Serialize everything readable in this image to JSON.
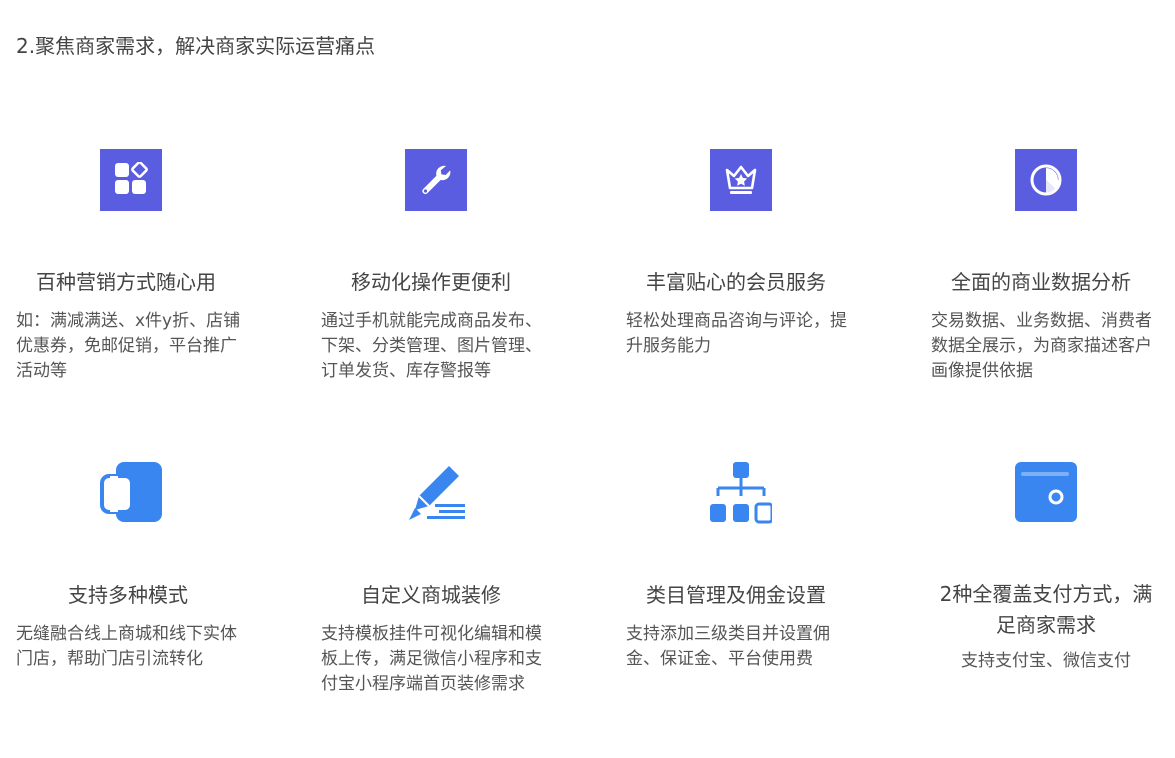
{
  "section": {
    "title": "2.聚焦商家需求，解决商家实际运营痛点"
  },
  "colors": {
    "row1_icon": "#5b5de0",
    "row2_icon": "#3a86f0"
  },
  "features": [
    {
      "icon": "apps-grid-icon",
      "title": "百种营销方式随心用",
      "desc": "如：满减满送、x件y折、店铺优惠券，免邮促销，平台推广活动等"
    },
    {
      "icon": "wrench-icon",
      "title": "移动化操作更便利",
      "desc": "通过手机就能完成商品发布、下架、分类管理、图片管理、订单发货、库存警报等"
    },
    {
      "icon": "crown-star-icon",
      "title": "丰富贴心的会员服务",
      "desc": "轻松处理商品咨询与评论，提升服务能力"
    },
    {
      "icon": "pie-chart-icon",
      "title": "全面的商业数据分析",
      "desc": "交易数据、业务数据、消费者数据全展示，为商家描述客户画像提供依据"
    },
    {
      "icon": "dual-mode-icon",
      "title": "支持多种模式",
      "desc": "无缝融合线上商城和线下实体门店，帮助门店引流转化"
    },
    {
      "icon": "pencil-edit-icon",
      "title": "自定义商城装修",
      "desc": "支持模板挂件可视化编辑和模板上传，满足微信小程序和支付宝小程序端首页装修需求"
    },
    {
      "icon": "hierarchy-icon",
      "title": "类目管理及佣金设置",
      "desc": "支持添加三级类目并设置佣金、保证金、平台使用费"
    },
    {
      "icon": "wallet-icon",
      "title": "2种全覆盖支付方式，满足商家需求",
      "desc": "支持支付宝、微信支付"
    }
  ]
}
